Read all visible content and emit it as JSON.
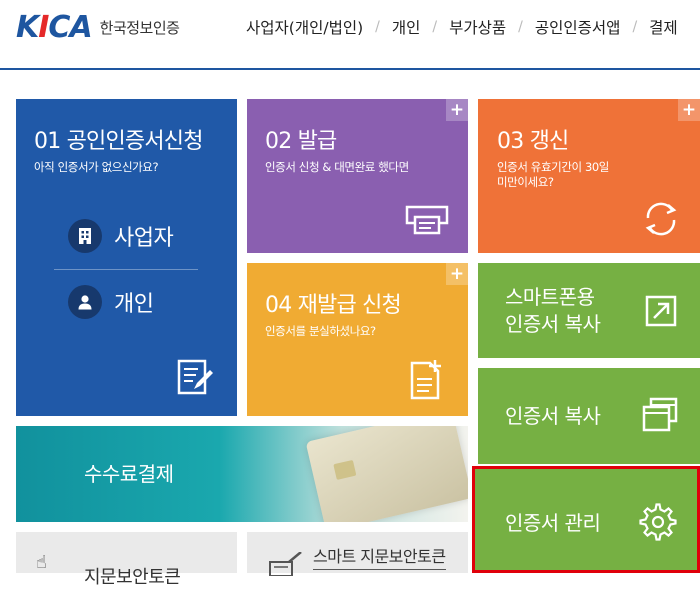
{
  "header": {
    "logo": "KICA",
    "logo_subtitle": "한국정보인증",
    "nav": [
      "사업자(개인/법인)",
      "개인",
      "부가상품",
      "공인인증서앱",
      "결제"
    ]
  },
  "tiles": {
    "apply": {
      "title": "01 공인인증서신청",
      "subtitle": "아직 인증서가 없으신가요?",
      "items": [
        "사업자",
        "개인"
      ]
    },
    "issue": {
      "title": "02 발급",
      "subtitle": "인증서 신청 & 대면완료 했다면",
      "plus": "+"
    },
    "renew": {
      "title": "03 갱신",
      "subtitle_line1": "인증서 유효기간이 30일",
      "subtitle_line2": "미만이세요?",
      "plus": "+"
    },
    "reissue": {
      "title": "04 재발급 신청",
      "subtitle": "인증서를 분실하셨나요?",
      "plus": "+"
    },
    "smartphone_copy": {
      "line1": "스마트폰용",
      "line2": "인증서 복사"
    },
    "cert_copy": {
      "label": "인증서 복사"
    },
    "cert_manage": {
      "label": "인증서 관리"
    },
    "fee_payment": {
      "label": "수수료결제"
    },
    "fingerprint_token": {
      "label": "지문보안토큰"
    },
    "smart_fingerprint_token": {
      "label": "스마트 지문보안토큰"
    }
  },
  "colors": {
    "blue": "#2059a8",
    "purple": "#8a5fb0",
    "orange": "#ef7238",
    "yellow": "#f0ab33",
    "green": "#76b043",
    "teal": "#139da6",
    "highlight": "#e0000a"
  }
}
